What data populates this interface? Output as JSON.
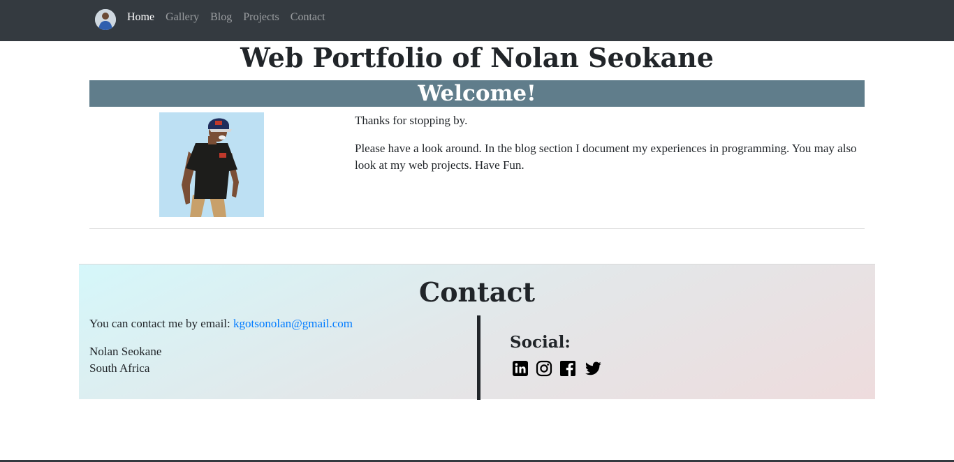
{
  "nav": {
    "links": [
      {
        "label": "Home",
        "active": true
      },
      {
        "label": "Gallery",
        "active": false
      },
      {
        "label": "Blog",
        "active": false
      },
      {
        "label": "Projects",
        "active": false
      },
      {
        "label": "Contact",
        "active": false
      }
    ],
    "background": "#343a40"
  },
  "header": {
    "title": "Web Portfolio of Nolan Seokane",
    "welcome": "Welcome!",
    "welcome_bg": "#607d8b"
  },
  "intro": {
    "paragraphs": [
      "Thanks for stopping by.",
      "Please have a look around. In the blog section I document my experiences in programming. You may also look at my web projects. Have Fun."
    ]
  },
  "contact": {
    "title": "Contact",
    "email_prefix": "You can contact me by email: ",
    "email": "kgotsonolan@gmail.com",
    "address_lines": [
      "Nolan Seokane",
      "South Africa"
    ],
    "social_heading": "Social:",
    "social_icons": [
      "linkedin-icon",
      "instagram-icon",
      "facebook-icon",
      "twitter-icon"
    ],
    "link_color": "#007bff"
  }
}
